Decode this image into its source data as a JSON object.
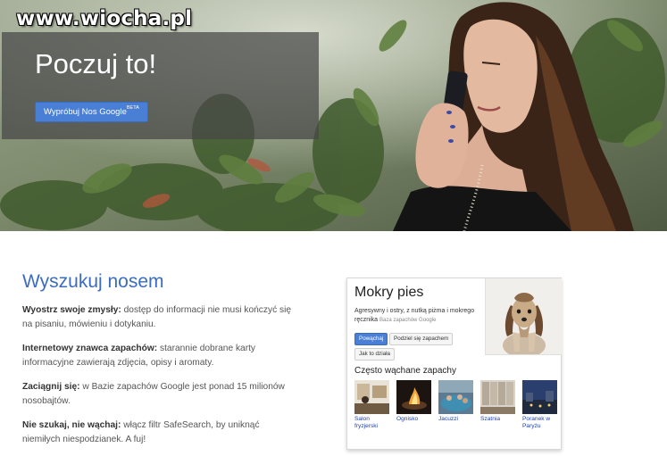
{
  "watermark": "www.wiocha.pl",
  "hero": {
    "title": "Poczuj to!",
    "button_label": "Wypróbuj Nos Google",
    "button_sup": "BETA"
  },
  "main": {
    "heading": "Wyszukuj nosem",
    "features": [
      {
        "bold": "Wyostrz swoje zmysły:",
        "text": " dostęp do informacji nie musi kończyć się na pisaniu, mówieniu i dotykaniu."
      },
      {
        "bold": "Internetowy znawca zapachów:",
        "text": " starannie dobrane karty informacyjne zawierają zdjęcia, opisy i aromaty."
      },
      {
        "bold": "Zaciągnij się:",
        "text": " w Bazie zapachów Google jest ponad 15 milionów nosobajtów."
      },
      {
        "bold": "Nie szukaj, nie wąchaj:",
        "text": " włącz filtr SafeSearch, by uniknąć niemiłych niespodzianek. A fuj!"
      }
    ]
  },
  "card": {
    "title": "Mokry pies",
    "description": "Agresywny i ostry, z nutką piżma i mokrego ręcznika",
    "source": "Baza zapachów Google",
    "sniff_label": "Powąchaj",
    "share_label": "Podziel się zapachem",
    "how_label": "Jak to działa",
    "often_title": "Często wąchane zapachy",
    "thumbs": [
      {
        "label": "Salon fryzjerski"
      },
      {
        "label": "Ognisko"
      },
      {
        "label": "Jacuzzi"
      },
      {
        "label": "Szatnia"
      },
      {
        "label": "Poranek w Paryżu"
      }
    ]
  },
  "colors": {
    "accent_blue": "#3b6cc0",
    "button_blue": "#4a7fd6",
    "link_blue": "#1a3fb8"
  }
}
